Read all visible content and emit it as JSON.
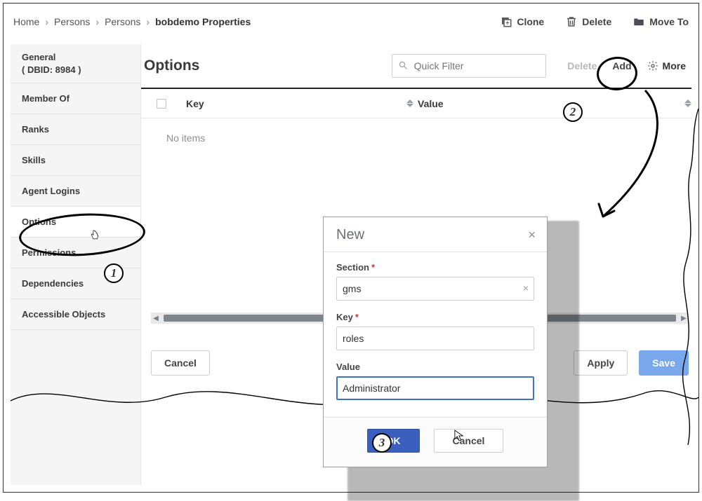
{
  "breadcrumb": {
    "items": [
      "Home",
      "Persons",
      "Persons",
      "bobdemo Properties"
    ]
  },
  "toolbar": {
    "clone": "Clone",
    "delete": "Delete",
    "moveTo": "Move To"
  },
  "sidebar": {
    "items": [
      {
        "label": "General\n( DBID: 8984 )"
      },
      {
        "label": "Member Of"
      },
      {
        "label": "Ranks"
      },
      {
        "label": "Skills"
      },
      {
        "label": "Agent Logins"
      },
      {
        "label": "Options"
      },
      {
        "label": "Permissions"
      },
      {
        "label": "Dependencies"
      },
      {
        "label": "Accessible Objects"
      }
    ],
    "activeIndex": 5
  },
  "options": {
    "title": "Options",
    "filterPlaceholder": "Quick Filter",
    "actions": {
      "delete": "Delete",
      "add": "Add",
      "more": "More"
    },
    "columns": {
      "key": "Key",
      "value": "Value"
    },
    "noItems": "No items",
    "buttons": {
      "cancel": "Cancel",
      "apply": "Apply",
      "save": "Save"
    }
  },
  "dialog": {
    "title": "New",
    "sectionLabel": "Section",
    "keyLabel": "Key",
    "valueLabel": "Value",
    "sectionValue": "gms",
    "keyValue": "roles",
    "valueValue": "Administrator",
    "ok": "OK",
    "cancel": "Cancel"
  }
}
